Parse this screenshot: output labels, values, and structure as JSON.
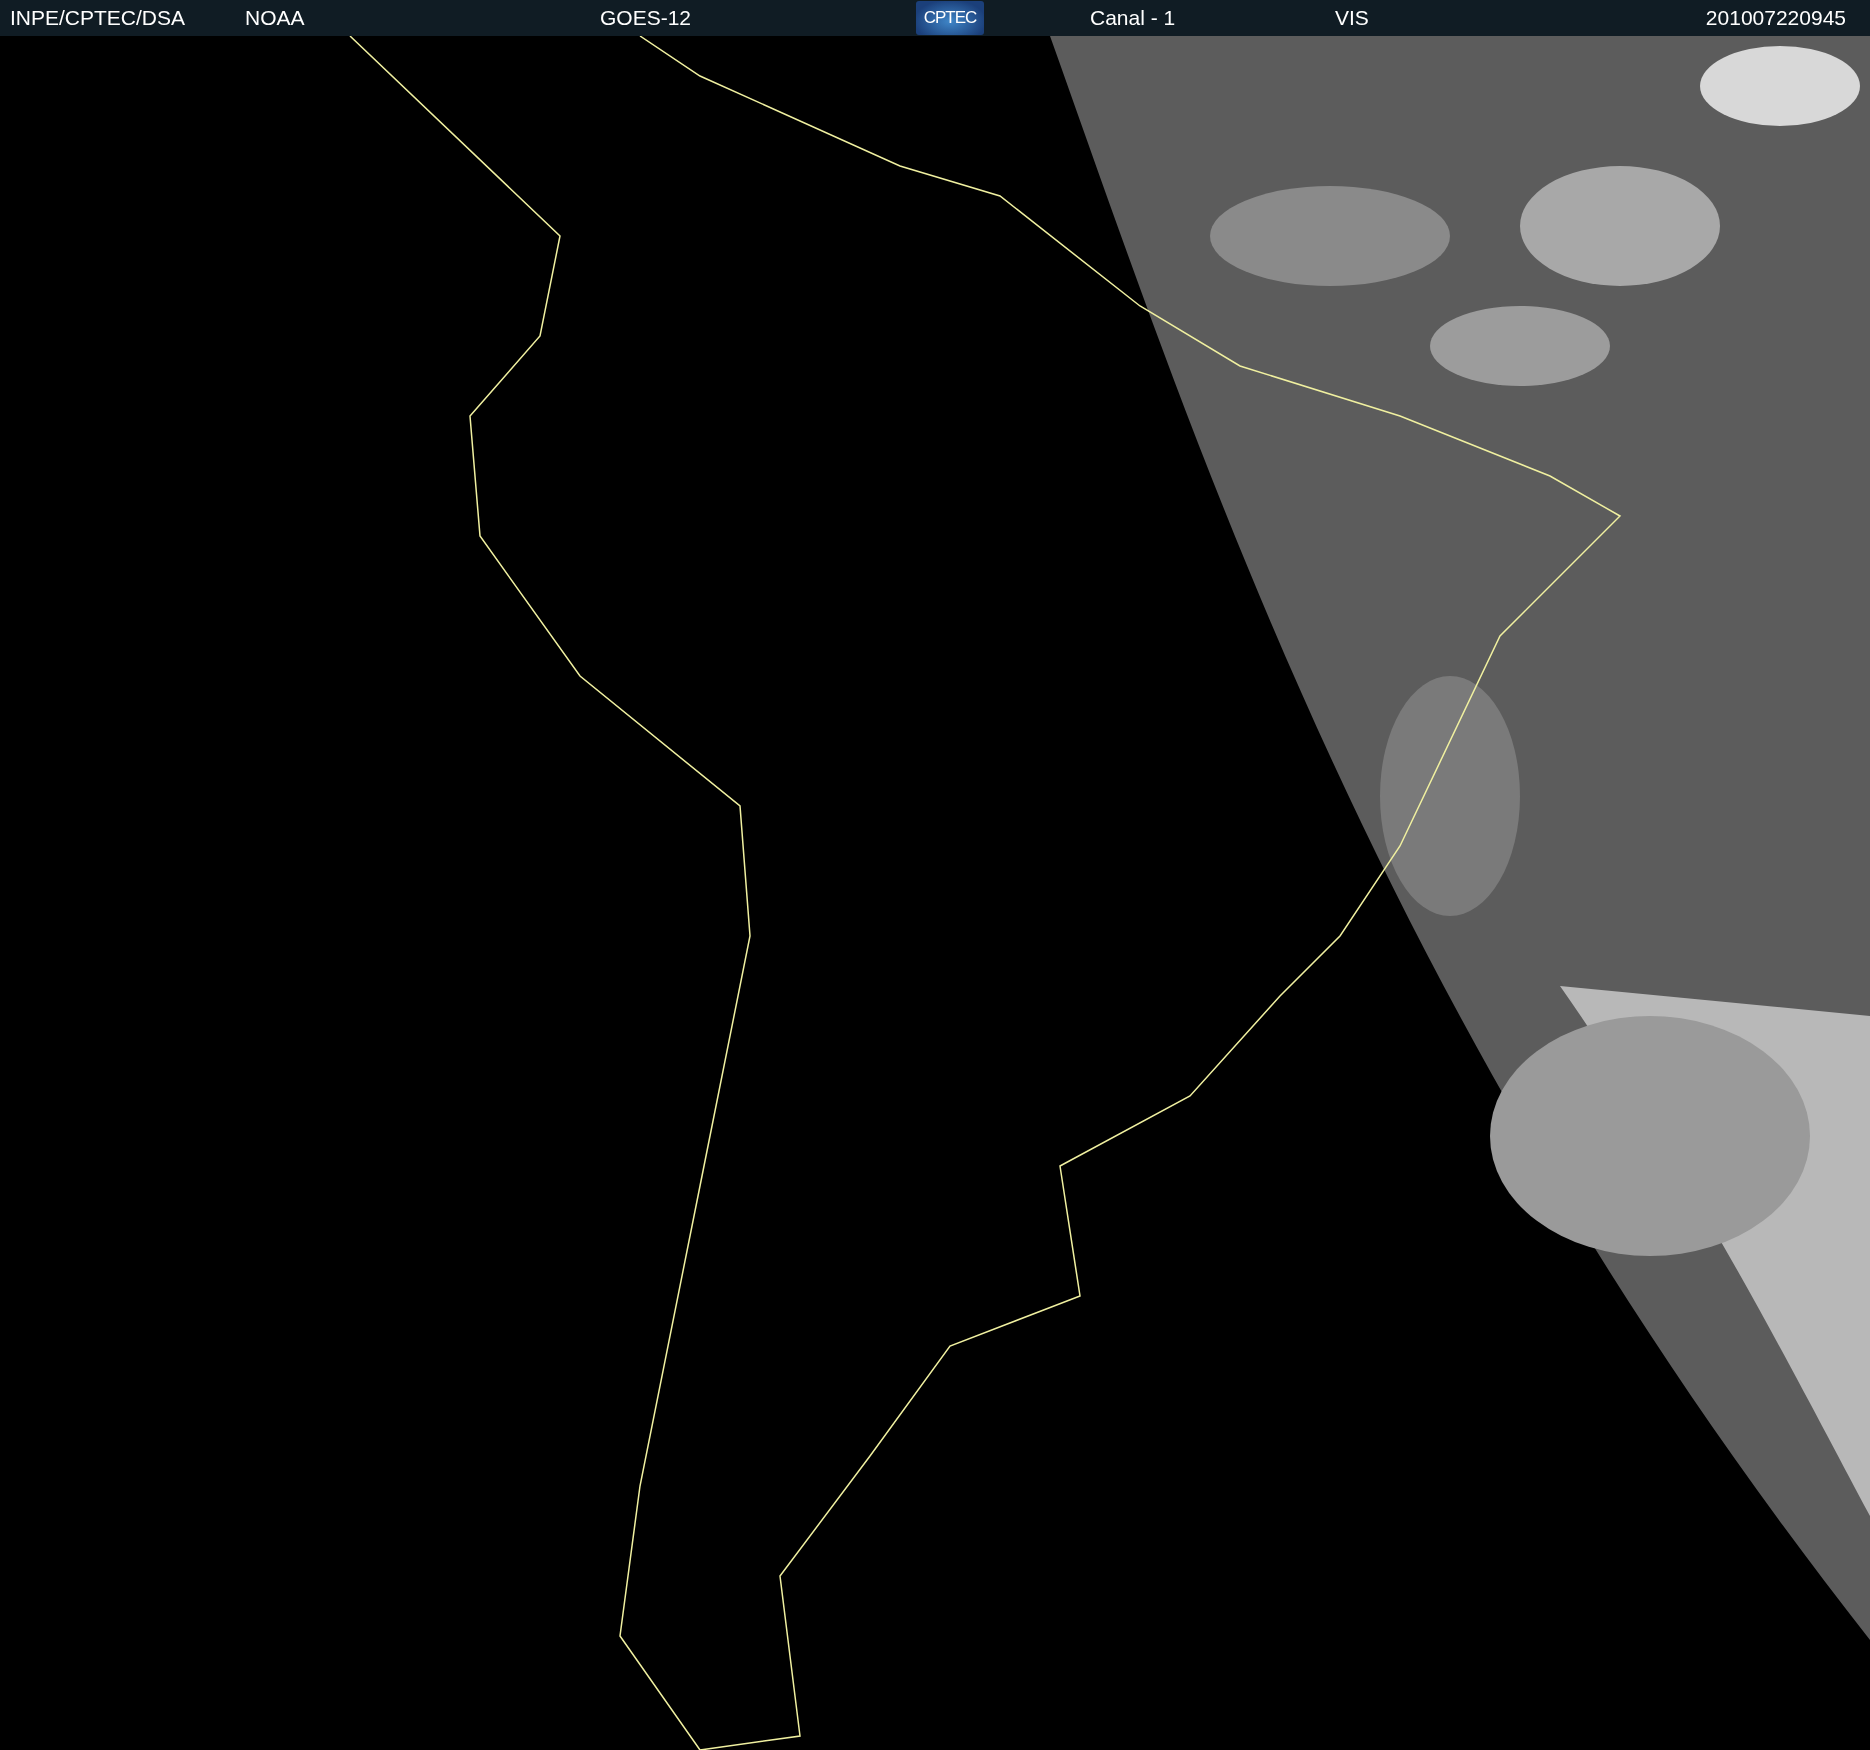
{
  "header": {
    "items": [
      {
        "kind": "text",
        "text": "INPE/CPTEC/DSA"
      },
      {
        "kind": "text",
        "text": "NOAA"
      },
      {
        "kind": "text",
        "text": "GOES-12"
      },
      {
        "kind": "logo",
        "text": "CPTEC"
      },
      {
        "kind": "text",
        "text": "Canal - 1"
      },
      {
        "kind": "text",
        "text": "VIS"
      },
      {
        "kind": "text",
        "text": "201007220945"
      }
    ]
  }
}
